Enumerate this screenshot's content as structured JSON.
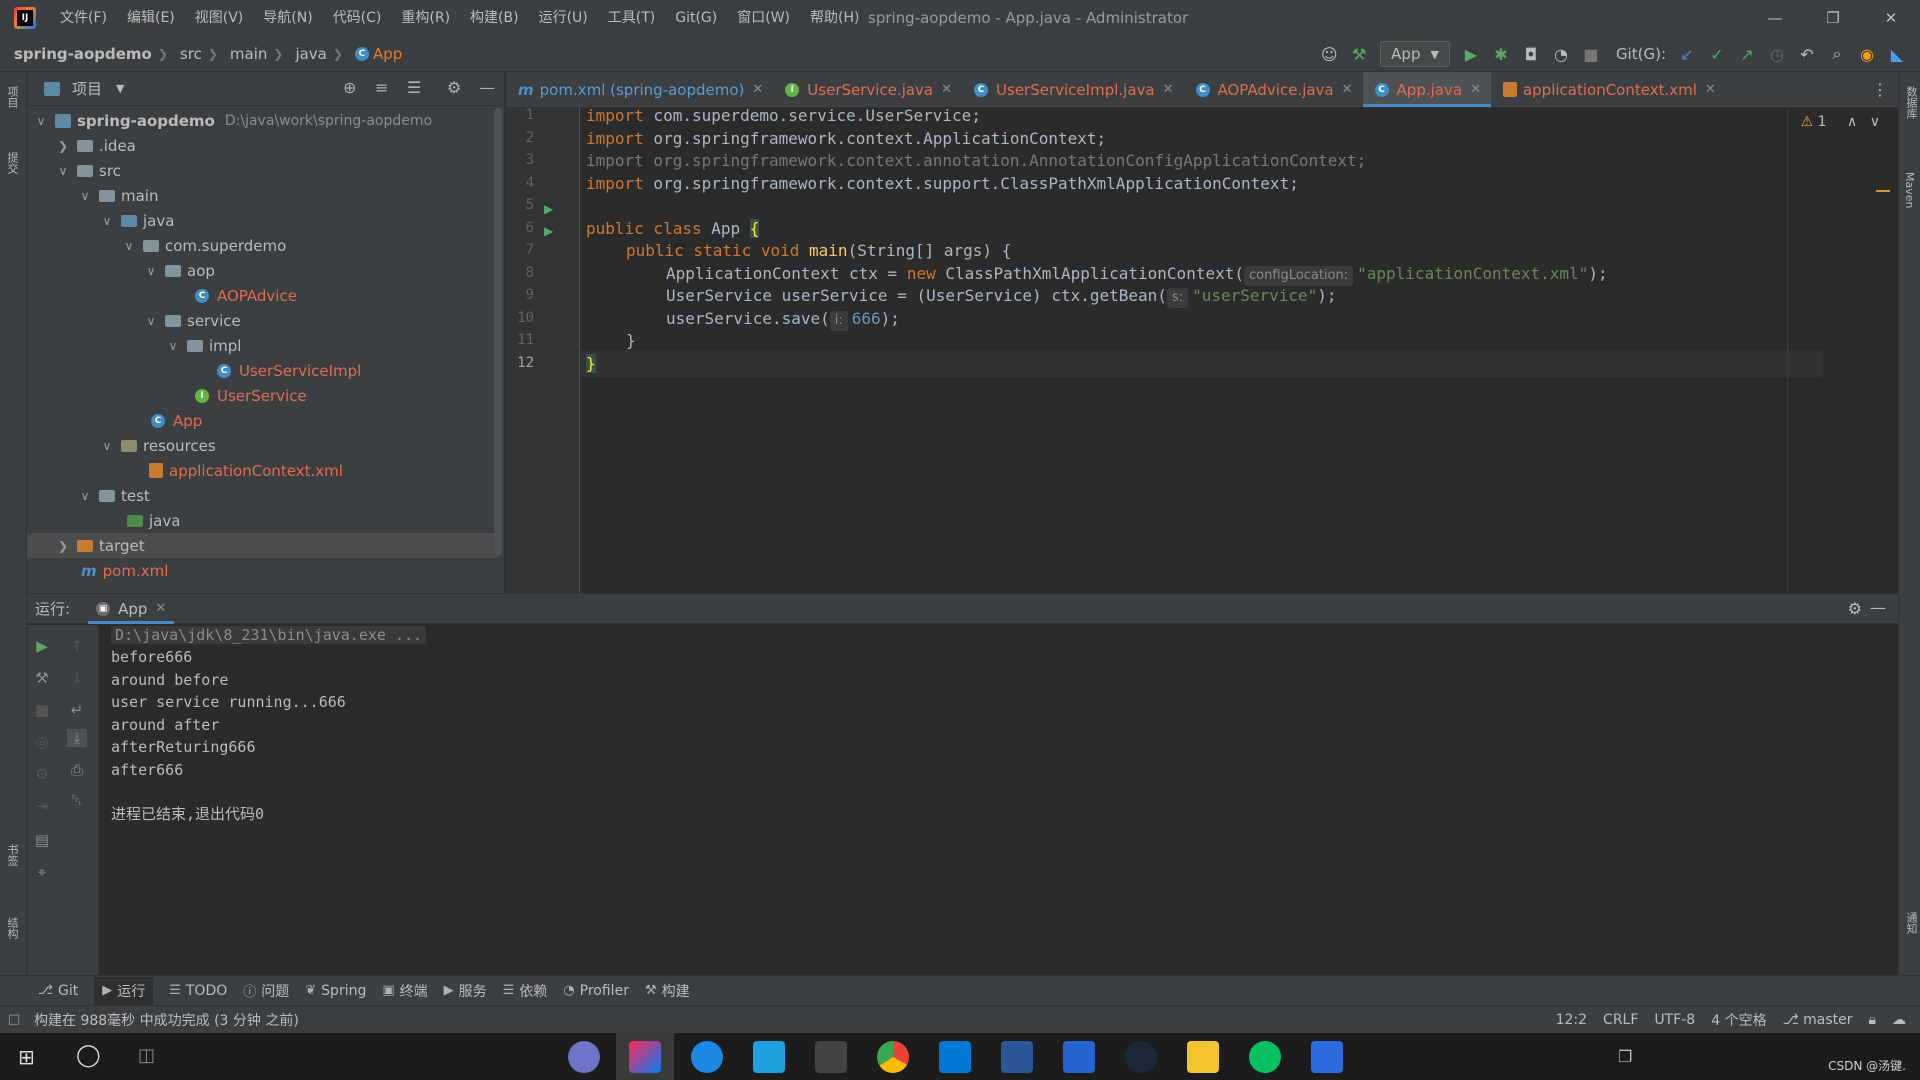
{
  "menu": [
    "文件(F)",
    "编辑(E)",
    "视图(V)",
    "导航(N)",
    "代码(C)",
    "重构(R)",
    "构建(B)",
    "运行(U)",
    "工具(T)",
    "Git(G)",
    "窗口(W)",
    "帮助(H)"
  ],
  "window_title": "spring-aopdemo - App.java - Administrator",
  "breadcrumbs": [
    "spring-aopdemo",
    "src",
    "main",
    "java",
    "App"
  ],
  "toolbar": {
    "run_config": "App",
    "git_label": "Git(G):"
  },
  "project_panel": {
    "title": "项目",
    "rows": [
      {
        "label": "spring-aopdemo",
        "path": "D:\\java\\work\\spring-aopdemo"
      },
      {
        "label": ".idea"
      },
      {
        "label": "src"
      },
      {
        "label": "main"
      },
      {
        "label": "java"
      },
      {
        "label": "com.superdemo"
      },
      {
        "label": "aop"
      },
      {
        "label": "AOPAdvice"
      },
      {
        "label": "service"
      },
      {
        "label": "impl"
      },
      {
        "label": "UserServiceImpl"
      },
      {
        "label": "UserService"
      },
      {
        "label": "App"
      },
      {
        "label": "resources"
      },
      {
        "label": "applicationContext.xml"
      },
      {
        "label": "test"
      },
      {
        "label": "java"
      },
      {
        "label": "target"
      },
      {
        "label": "pom.xml"
      }
    ]
  },
  "tabs": [
    {
      "label": "pom.xml (spring-aopdemo)"
    },
    {
      "label": "UserService.java"
    },
    {
      "label": "UserServiceImpl.java"
    },
    {
      "label": "AOPAdvice.java"
    },
    {
      "label": "App.java"
    },
    {
      "label": "applicationContext.xml"
    }
  ],
  "editor": {
    "line_numbers": [
      "1",
      "2",
      "3",
      "4",
      "5",
      "6",
      "7",
      "8",
      "9",
      "10",
      "11",
      "12"
    ],
    "warning_count": "1",
    "code": {
      "l1_kw": "import",
      "l1_rest": " com.superdemo.service.UserService;",
      "l2_kw": "import",
      "l2_rest": " org.springframework.context.ApplicationContext;",
      "l3_text": "import org.springframework.context.annotation.AnnotationConfigApplicationContext;",
      "l4_kw": "import",
      "l4_rest": " org.springframework.context.support.ClassPathXmlApplicationContext;",
      "l6_kw": "public class",
      "l6_name": " App ",
      "l6_brace": "{",
      "l7_kw": "public static void",
      "l7_fn": " main",
      "l7_rest": "(String[] args) {",
      "l8_a": "ApplicationContext ctx = ",
      "l8_kw": "new",
      "l8_b": " ClassPathXmlApplicationContext(",
      "l8_hint": "configLocation:",
      "l8_str": "\"applicationContext.xml\"",
      "l8_end": ");",
      "l9_a": "UserService userService = (UserService) ctx.getBean(",
      "l9_hint": "s:",
      "l9_str": "\"userService\"",
      "l9_end": ");",
      "l10_a": "userService.save(",
      "l10_hint": "i:",
      "l10_num": "666",
      "l10_end": ");",
      "l11": "}",
      "l12": "}"
    }
  },
  "run_panel": {
    "label": "运行:",
    "tab": "App",
    "console": [
      "D:\\java\\jdk\\8_231\\bin\\java.exe ...",
      "before666",
      "around before",
      "user service running...666",
      "around after",
      "afterReturing666",
      "after666",
      "",
      "进程已结束,退出代码0"
    ]
  },
  "bottom_tools": [
    "Git",
    "运行",
    "TODO",
    "问题",
    "Spring",
    "终端",
    "服务",
    "依赖",
    "Profiler",
    "构建"
  ],
  "status": {
    "message": "构建在 988毫秒 中成功完成 (3 分钟 之前)",
    "position": "12:2",
    "line_sep": "CRLF",
    "encoding": "UTF-8",
    "indent": "4 个空格",
    "branch": "master"
  },
  "left_strip_labels": [
    "项目",
    "提交",
    "书签",
    "结构"
  ],
  "right_strip_labels": [
    "数据库",
    "Maven",
    "通知"
  ],
  "watermark": "CSDN @汤键.",
  "colors": {
    "accent": "#4a88c7",
    "keyword": "#cc7832",
    "string": "#6a8759",
    "number": "#6897bb",
    "error_file": "#e06c4f"
  }
}
